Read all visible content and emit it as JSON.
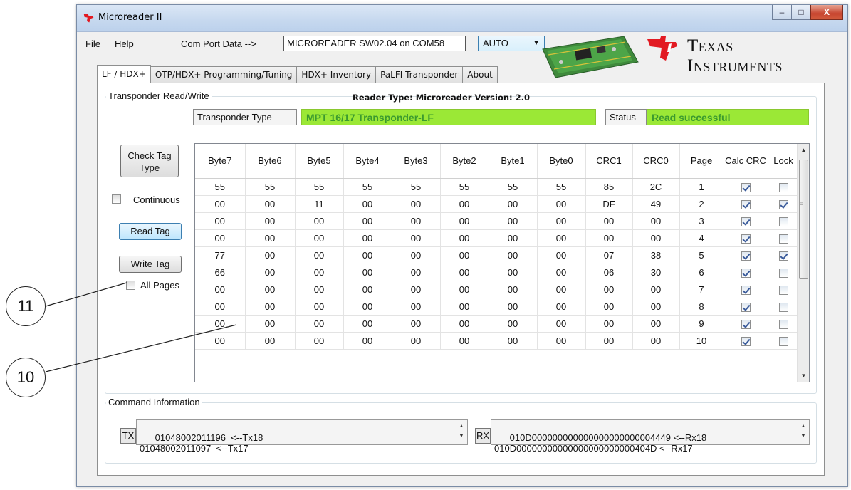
{
  "window": {
    "title": "Microreader II",
    "minimize": "–",
    "maximize": "□",
    "close": "X"
  },
  "menu": {
    "file": "File",
    "help": "Help"
  },
  "comport": {
    "label": "Com Port Data -->",
    "value": "MICROREADER SW02.04 on COM58",
    "mode": "AUTO"
  },
  "logo": {
    "line1": "Texas",
    "line2": "Instruments"
  },
  "tabs": [
    "LF / HDX+",
    "OTP/HDX+ Programming/Tuning",
    "HDX+ Inventory",
    "PaLFI Transponder",
    "About"
  ],
  "transponder": {
    "group_title": "Transponder Read/Write",
    "reader_type": "Reader Type: Microreader   Version: 2.0",
    "type_label": "Transponder Type",
    "type_value": "MPT 16/17 Transponder-LF",
    "status_label": "Status",
    "status_value": "Read successful"
  },
  "controls": {
    "check_tag": "Check Tag\nType",
    "continuous": "Continuous",
    "read_tag": "Read Tag",
    "write_tag": "Write Tag",
    "all_pages": "All Pages"
  },
  "table": {
    "headers": [
      "Byte7",
      "Byte6",
      "Byte5",
      "Byte4",
      "Byte3",
      "Byte2",
      "Byte1",
      "Byte0",
      "CRC1",
      "CRC0",
      "Page",
      "Calc CRC",
      "Lock"
    ],
    "rows": [
      {
        "cells": [
          "55",
          "55",
          "55",
          "55",
          "55",
          "55",
          "55",
          "55",
          "85",
          "2C",
          "1"
        ],
        "calc": true,
        "lock": false
      },
      {
        "cells": [
          "00",
          "00",
          "11",
          "00",
          "00",
          "00",
          "00",
          "00",
          "DF",
          "49",
          "2"
        ],
        "calc": true,
        "lock": true
      },
      {
        "cells": [
          "00",
          "00",
          "00",
          "00",
          "00",
          "00",
          "00",
          "00",
          "00",
          "00",
          "3"
        ],
        "calc": true,
        "lock": false
      },
      {
        "cells": [
          "00",
          "00",
          "00",
          "00",
          "00",
          "00",
          "00",
          "00",
          "00",
          "00",
          "4"
        ],
        "calc": true,
        "lock": false
      },
      {
        "cells": [
          "77",
          "00",
          "00",
          "00",
          "00",
          "00",
          "00",
          "00",
          "07",
          "38",
          "5"
        ],
        "calc": true,
        "lock": true
      },
      {
        "cells": [
          "66",
          "00",
          "00",
          "00",
          "00",
          "00",
          "00",
          "00",
          "06",
          "30",
          "6"
        ],
        "calc": true,
        "lock": false
      },
      {
        "cells": [
          "00",
          "00",
          "00",
          "00",
          "00",
          "00",
          "00",
          "00",
          "00",
          "00",
          "7"
        ],
        "calc": true,
        "lock": false
      },
      {
        "cells": [
          "00",
          "00",
          "00",
          "00",
          "00",
          "00",
          "00",
          "00",
          "00",
          "00",
          "8"
        ],
        "calc": true,
        "lock": false
      },
      {
        "cells": [
          "00",
          "00",
          "00",
          "00",
          "00",
          "00",
          "00",
          "00",
          "00",
          "00",
          "9"
        ],
        "calc": true,
        "lock": false
      },
      {
        "cells": [
          "00",
          "00",
          "00",
          "00",
          "00",
          "00",
          "00",
          "00",
          "00",
          "00",
          "10"
        ],
        "calc": true,
        "lock": false
      }
    ]
  },
  "command": {
    "group_title": "Command Information",
    "tx_label": "TX",
    "tx_text": "01048002011196  <--Tx18\n01048002011097  <--Tx17",
    "rx_label": "RX",
    "rx_text": "010D000000000000000000000004449 <--Rx18\n010D00000000000000000000000404D <--Rx17"
  },
  "callouts": {
    "a": "11",
    "b": "10"
  },
  "colors": {
    "status_green": "#9be836",
    "status_text": "#3b9a2f",
    "ti_red": "#e21a22"
  }
}
